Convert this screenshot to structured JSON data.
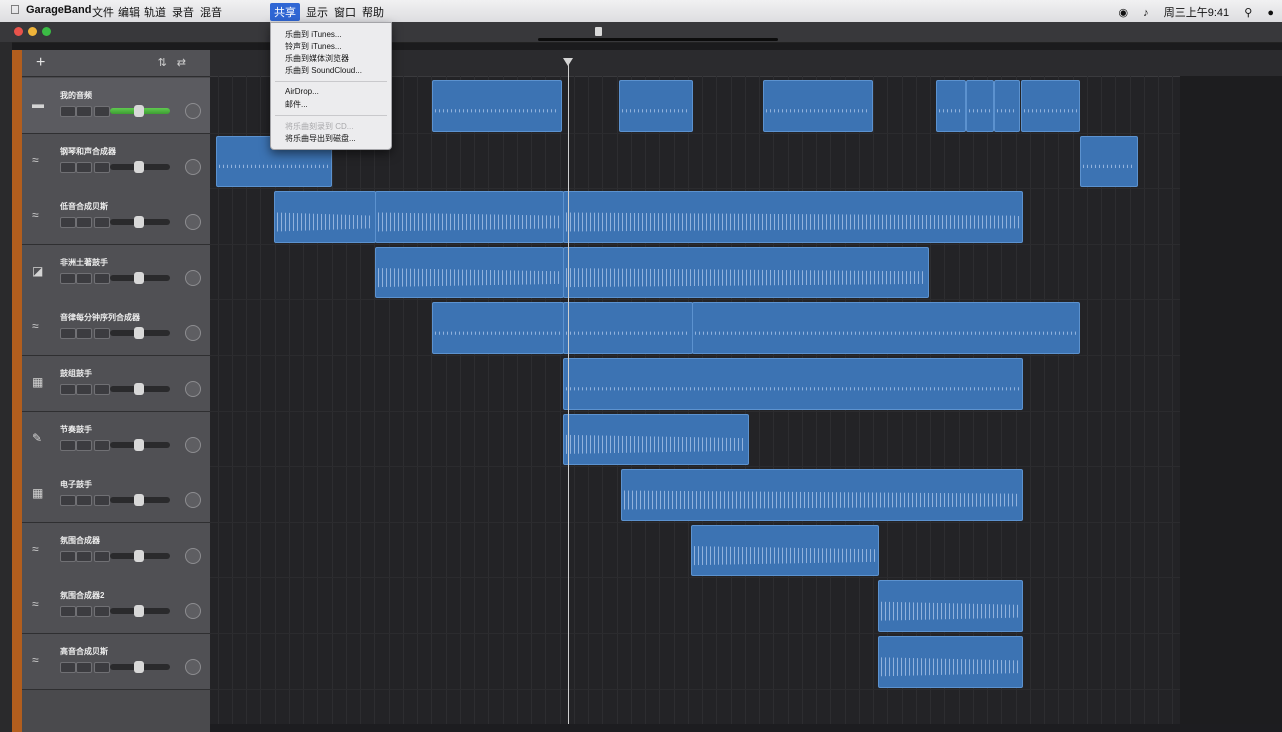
{
  "menubar": {
    "app_name": "GarageBand",
    "menus": [
      "文件",
      "编辑",
      "轨道",
      "录音",
      "混音",
      "共享",
      "显示",
      "窗口",
      "帮助"
    ],
    "active_menu": "共享",
    "status": {
      "time": "周三上午9:41"
    }
  },
  "share_menu": {
    "items": [
      "乐曲到 iTunes...",
      "铃声到 iTunes...",
      "乐曲到媒体浏览器",
      "乐曲到 SoundCloud...",
      "AirDrop...",
      "邮件...",
      "将乐曲刻录到 CD...",
      "将乐曲导出到磁盘..."
    ]
  },
  "tracks": [
    {
      "name": "我的音频",
      "icon": "microphone-icon"
    },
    {
      "name": "钢琴和声合成器",
      "icon": "synth-icon"
    },
    {
      "name": "低音合成贝斯",
      "icon": "synth-icon"
    },
    {
      "name": "非洲土著鼓手",
      "icon": "drum-kit-icon"
    },
    {
      "name": "音律每分钟序列合成器",
      "icon": "synth-icon"
    },
    {
      "name": "鼓组鼓手",
      "icon": "drum-machine-icon"
    },
    {
      "name": "节奏鼓手",
      "icon": "guitar-icon"
    },
    {
      "name": "电子鼓手",
      "icon": "drum-machine-icon"
    },
    {
      "name": "氛围合成器",
      "icon": "synth-icon"
    },
    {
      "name": "氛围合成器2",
      "icon": "synth-icon"
    },
    {
      "name": "高音合成贝斯",
      "icon": "synth-icon"
    }
  ]
}
